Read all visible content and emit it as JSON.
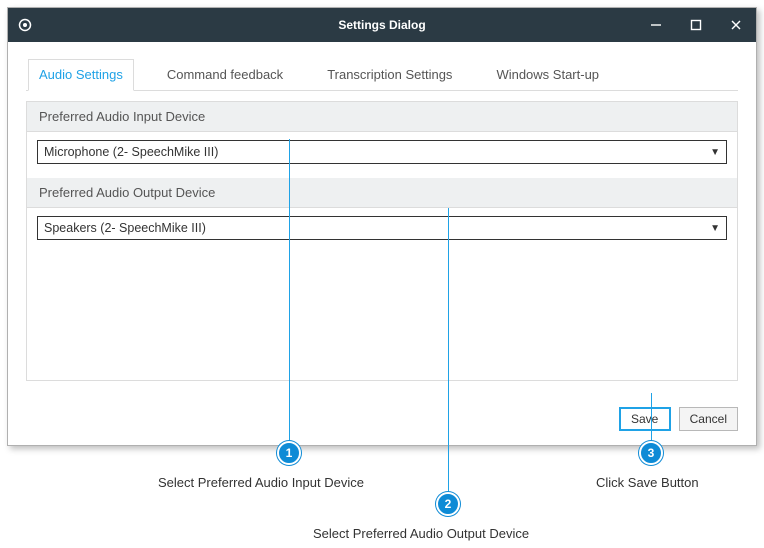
{
  "window": {
    "title": "Settings Dialog"
  },
  "tabs": [
    {
      "label": "Audio Settings",
      "active": true
    },
    {
      "label": "Command feedback",
      "active": false
    },
    {
      "label": "Transcription Settings",
      "active": false
    },
    {
      "label": "Windows Start-up",
      "active": false
    }
  ],
  "sections": {
    "input": {
      "header": "Preferred Audio Input Device",
      "value": "Microphone (2- SpeechMike III)"
    },
    "output": {
      "header": "Preferred Audio Output Device",
      "value": "Speakers (2- SpeechMike III)"
    }
  },
  "buttons": {
    "save": "Save",
    "cancel": "Cancel"
  },
  "annotations": {
    "a1": {
      "num": "1",
      "label": "Select Preferred Audio Input Device"
    },
    "a2": {
      "num": "2",
      "label": "Select Preferred Audio Output Device"
    },
    "a3": {
      "num": "3",
      "label": "Click Save Button"
    }
  }
}
